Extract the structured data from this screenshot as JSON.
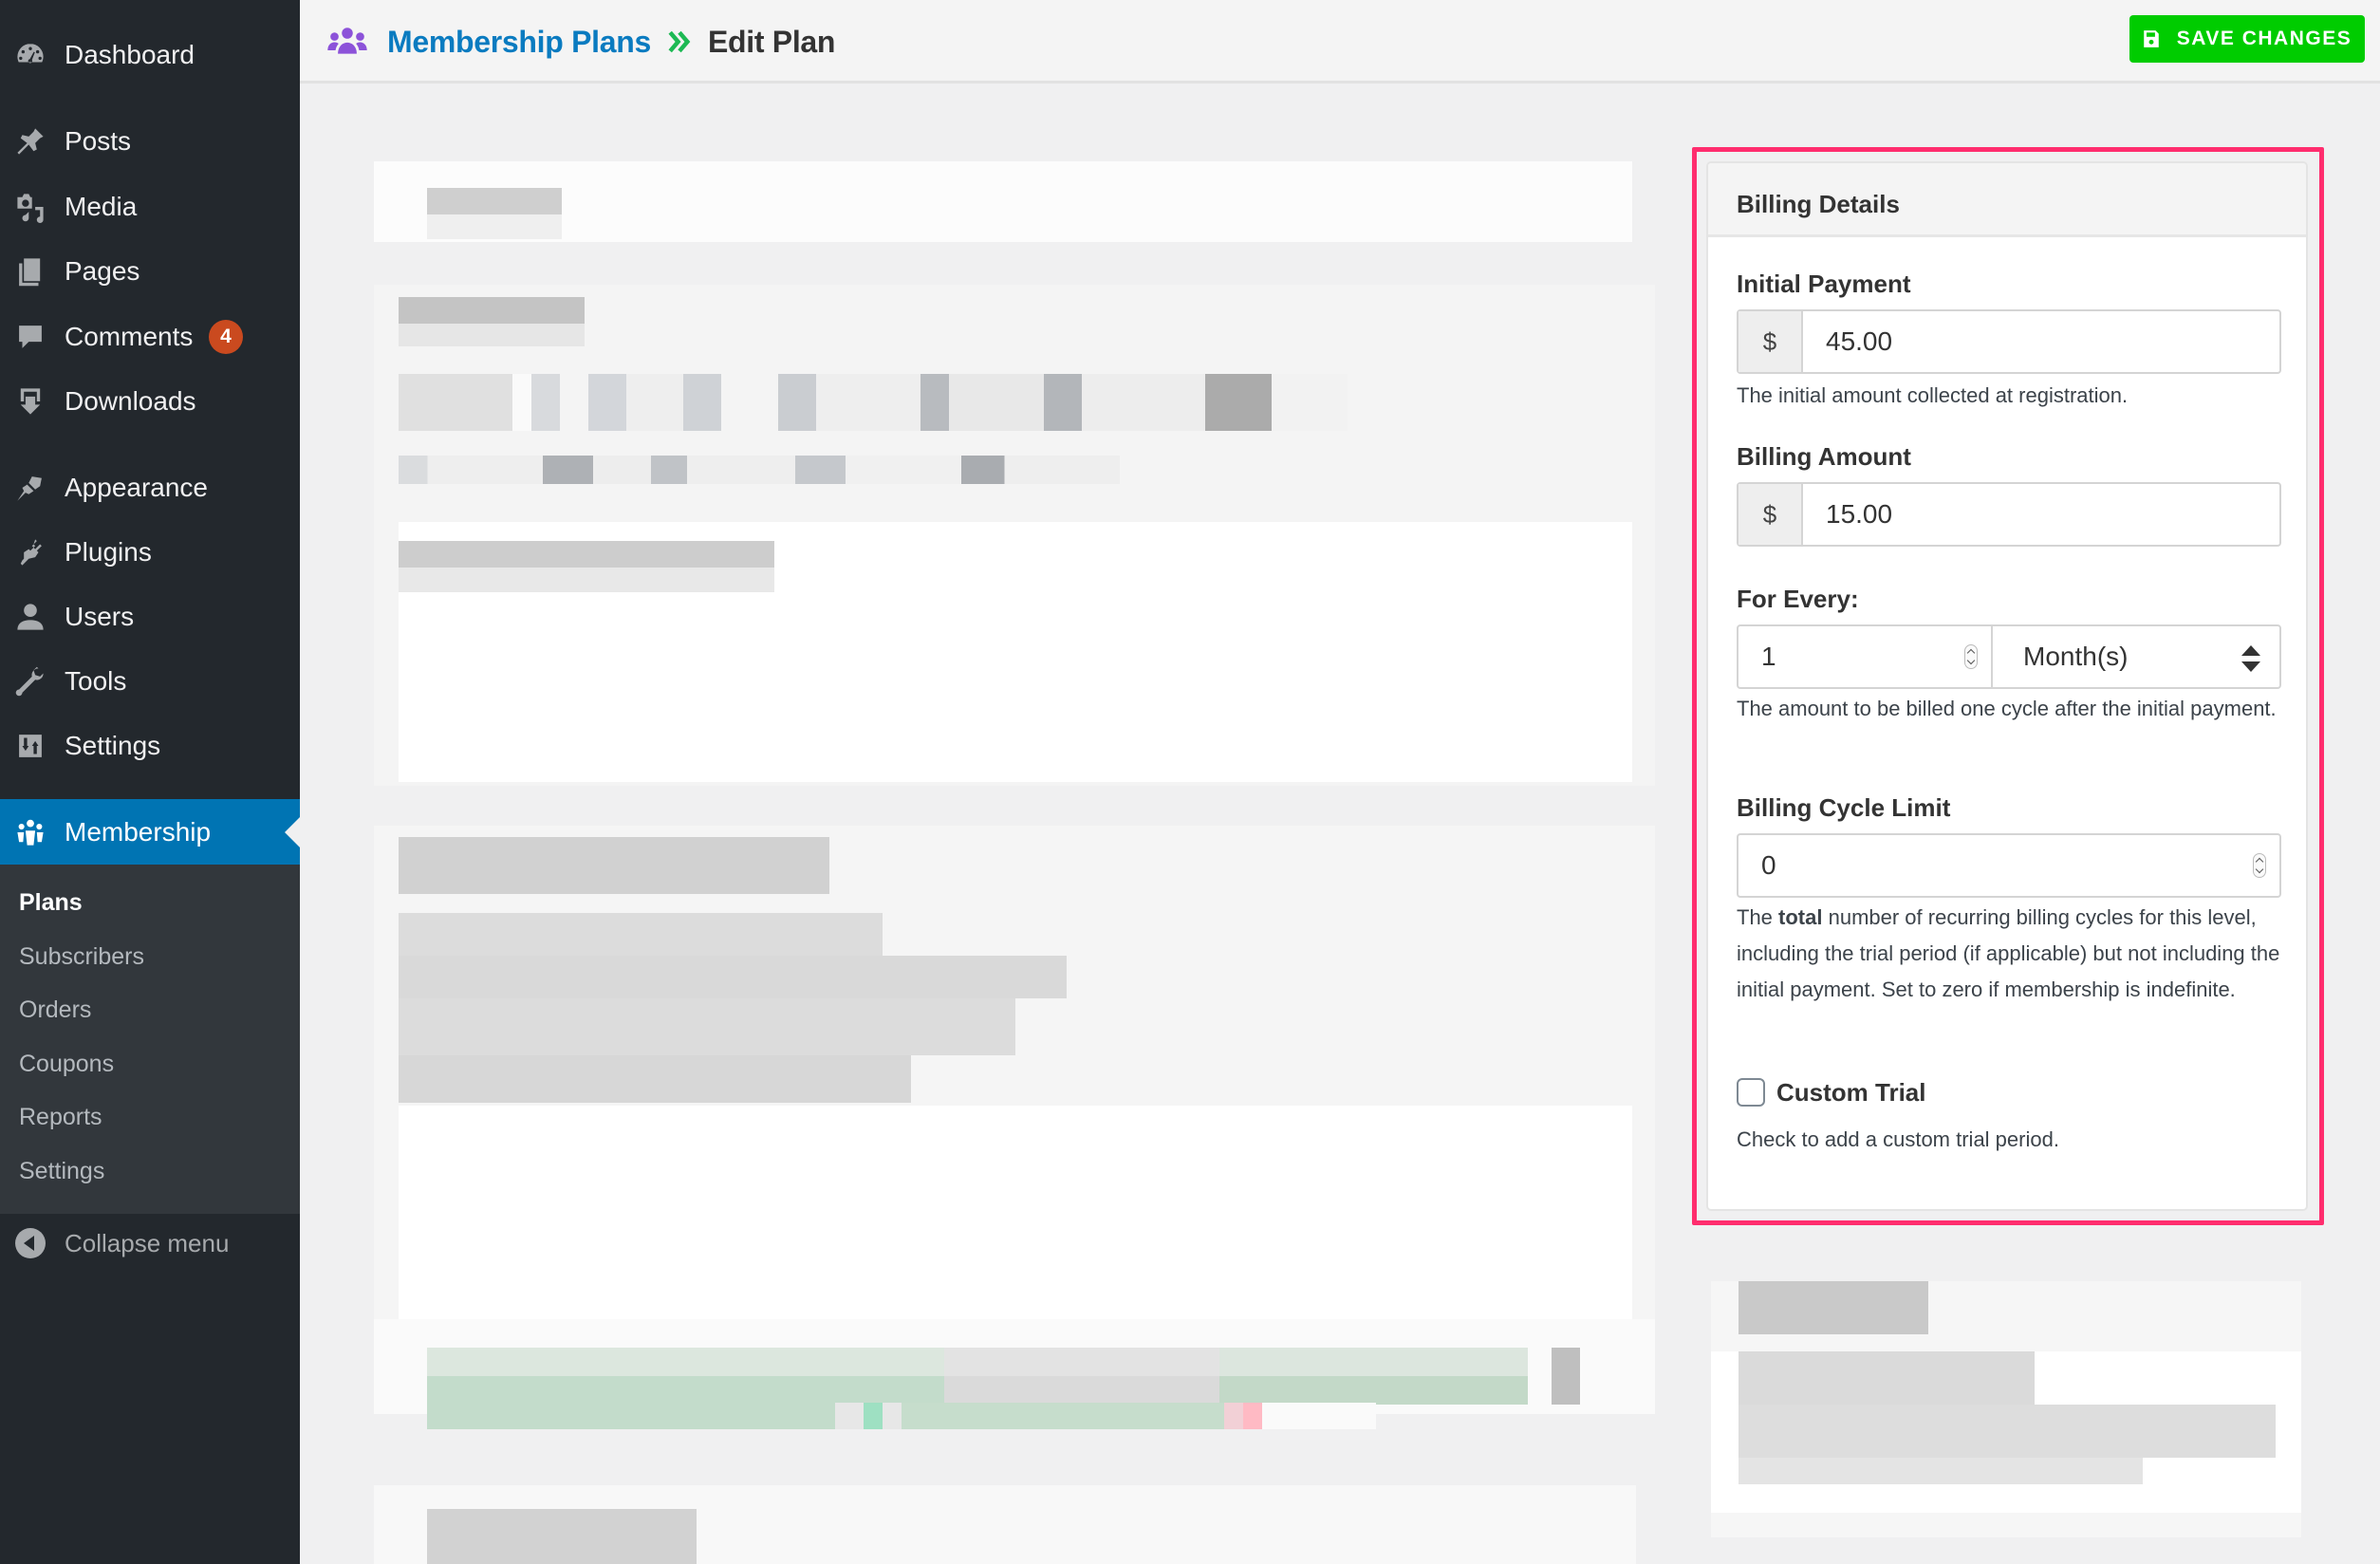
{
  "sidebar": {
    "menu": [
      {
        "label": "Dashboard",
        "icon": "dashboard-icon"
      },
      {
        "label": "Posts",
        "icon": "pushpin-icon"
      },
      {
        "label": "Media",
        "icon": "media-icon"
      },
      {
        "label": "Pages",
        "icon": "pages-icon"
      },
      {
        "label": "Comments",
        "icon": "comment-icon",
        "badge": "4"
      },
      {
        "label": "Downloads",
        "icon": "download-icon"
      },
      {
        "label": "Appearance",
        "icon": "paintbrush-icon"
      },
      {
        "label": "Plugins",
        "icon": "plug-icon"
      },
      {
        "label": "Users",
        "icon": "user-icon"
      },
      {
        "label": "Tools",
        "icon": "wrench-icon"
      },
      {
        "label": "Settings",
        "icon": "settings-sliders-icon"
      }
    ],
    "active": {
      "label": "Membership",
      "icon": "group-icon"
    },
    "submenu": [
      {
        "label": "Plans",
        "current": true
      },
      {
        "label": "Subscribers"
      },
      {
        "label": "Orders"
      },
      {
        "label": "Coupons"
      },
      {
        "label": "Reports"
      },
      {
        "label": "Settings"
      }
    ],
    "collapse_label": "Collapse menu"
  },
  "header": {
    "breadcrumb_parent": "Membership Plans",
    "breadcrumb_current": "Edit Plan",
    "save_label": "SAVE CHANGES"
  },
  "colors": {
    "highlight": "#ff2d6e",
    "save_button": "#00cc00",
    "link": "#0a7bc0",
    "active_menu": "#0074b3",
    "badge": "#ca4a1f",
    "breadcrumb_icon": "#8c52d9",
    "breadcrumb_separator": "#1db954"
  },
  "billing": {
    "title": "Billing Details",
    "initial_payment": {
      "label": "Initial Payment",
      "currency": "$",
      "value": "45.00",
      "help": "The initial amount collected at registration."
    },
    "billing_amount": {
      "label": "Billing Amount",
      "currency": "$",
      "value": "15.00"
    },
    "for_every": {
      "label": "For Every:",
      "number": "1",
      "period": "Month(s)",
      "help": "The amount to be billed one cycle after the initial payment."
    },
    "cycle_limit": {
      "label": "Billing Cycle Limit",
      "value": "0",
      "help_prefix": "The ",
      "help_bold": "total",
      "help_rest": " number of recurring billing cycles for this level, including the trial period (if applicable) but not including the initial payment. Set to zero if membership is indefinite."
    },
    "custom_trial": {
      "label": "Custom Trial",
      "checked": false,
      "help": "Check to add a custom trial period."
    }
  }
}
